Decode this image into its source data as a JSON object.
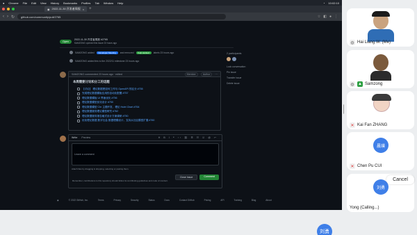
{
  "menubar": {
    "items": [
      "Chrome",
      "File",
      "Edit",
      "View",
      "History",
      "Bookmarks",
      "Profiles",
      "Tab",
      "Window",
      "Help"
    ],
    "clock": "10:02:10"
  },
  "browser": {
    "tab_title": "2022-11-30 开发者周报",
    "url": "github.com/community/pull/2765"
  },
  "issue": {
    "status": "Open",
    "title": "2022-11-30 开发者周报 #2765",
    "meta": "SAMZONG opened this issue 23 hours ago",
    "events": [
      {
        "text": "SAMZONG added",
        "label1": "Developer Meeting",
        "mid": "and removed",
        "label2": "help wanted",
        "tail": "labels 23 hours ago"
      },
      {
        "text": "SAMZONG added this to the 2022/11 milestone 23 hours ago"
      }
    ],
    "comment": {
      "header": "SAMZONG commented 23 hours ago · edited",
      "author_badges": [
        "Member",
        "Author"
      ],
      "heading": "本周需要讨论和分工的话题",
      "tasks": [
        "【讨论】 理论数据是如何工作与 OpenAPI 的区分 #755",
        "完成理论数据模板应用的自动化配置 #757",
        "理论数据模板 UI 界面优化 #756",
        "理论数据模型优化设计 #750",
        "理论数据模型 Chr 主题开发，理论 Hulei Chart #764",
        "理论数据服务理论模型研究 #762",
        "理论数据服务报告格式设计方案调研 #750",
        "优化理论数据 数字社会 数据理模设计，支持从社区模型扩展 #760"
      ]
    },
    "sidebar": {
      "participants_label": "2 participants",
      "links": [
        "Lock conversation",
        "Pin issue",
        "Transfer issue",
        "Delete issue"
      ]
    },
    "editor": {
      "tabs": [
        "Write",
        "Preview"
      ],
      "placeholder": "Leave a comment",
      "attach_hint": "Attach files by dragging & dropping, selecting or pasting them.",
      "close_btn": "Close issue",
      "comment_btn": "Comment",
      "contrib": "Remember, contributions to this repository should follow its contributing guidelines and code of conduct."
    },
    "footer": {
      "copyright": "© 2022 GitHub, Inc.",
      "links": [
        "Terms",
        "Privacy",
        "Security",
        "Status",
        "Docs",
        "Contact GitHub",
        "Pricing",
        "API",
        "Training",
        "Blog",
        "About"
      ]
    }
  },
  "video": {
    "participants": [
      {
        "name": "Hai Liang W. (Me)"
      },
      {
        "name": "Samzong"
      },
      {
        "name": "Kai Fan ZHANG"
      },
      {
        "name": "Chen Pu CUI",
        "avatar_text": "晨璞"
      },
      {
        "name": "Yong (Calling...)",
        "avatar_text": "刘勇"
      }
    ],
    "cancel": "Cancel",
    "self_avatar_text": "刘勇"
  },
  "colors": {
    "accent_green": "#238636",
    "page_bg": "#0d1117",
    "avatar_blue": "#3f7fe8"
  }
}
